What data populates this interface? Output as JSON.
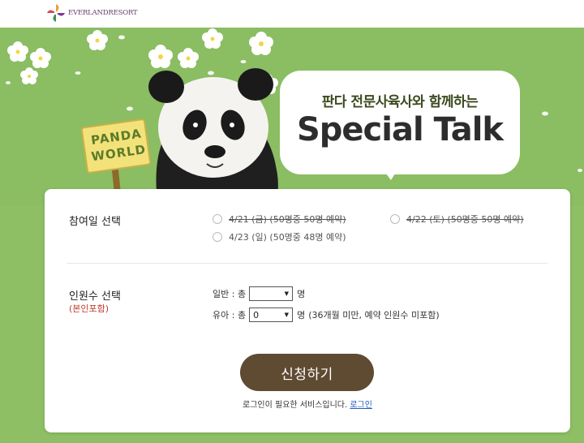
{
  "header": {
    "logo_text": "EVERLANDRESORT"
  },
  "banner": {
    "sign_line1": "PANDA",
    "sign_line2": "WORLD",
    "title_part1": "판다 전문사육사",
    "title_part2": "와 함께하는",
    "title_big": "Special Talk"
  },
  "form": {
    "date_label": "참여일 선택",
    "dates": [
      {
        "text": "4/21 (금) (50명중 50명 예약)",
        "disabled": true
      },
      {
        "text": "4/22 (토) (50명중 50명 예약)",
        "disabled": true
      },
      {
        "text": "4/23 (일) (50명중 48명 예약)",
        "disabled": false
      }
    ],
    "count_label": "인원수 선택",
    "count_sub": "(본인포함)",
    "adult_label": "일반 : 총",
    "adult_value": "",
    "adult_unit": "명",
    "child_label": "유아 : 총",
    "child_value": "0",
    "child_unit": "명",
    "child_note": "(36개월 미만, 예약 인원수 미포함)",
    "apply_label": "신청하기",
    "login_note": "로그인이 필요한 서비스입니다.",
    "login_link": "로그인"
  }
}
